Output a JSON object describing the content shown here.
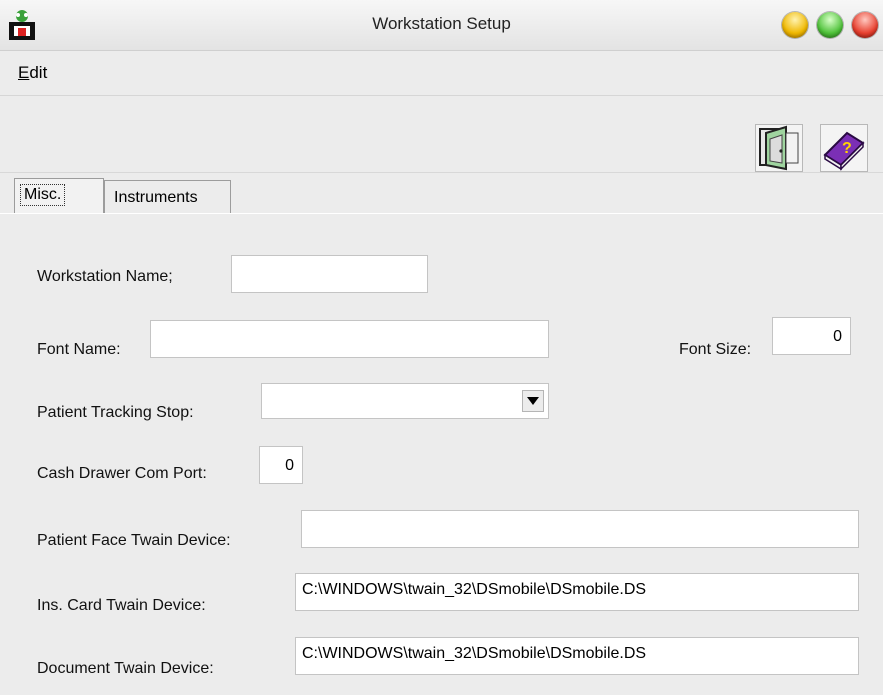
{
  "window": {
    "title": "Workstation Setup",
    "app_icon": "app-logo-icon",
    "controls": [
      "minimize-button",
      "zoom-button",
      "close-button"
    ]
  },
  "menu": {
    "items": [
      "Edit"
    ]
  },
  "toolbar": {
    "buttons": [
      {
        "icon": "exit-door-icon"
      },
      {
        "icon": "help-book-icon"
      }
    ]
  },
  "tabs": [
    {
      "label": "Misc.",
      "active": true
    },
    {
      "label": "Instruments",
      "active": false
    }
  ],
  "form": {
    "workstation_name": {
      "label": "Workstation Name;",
      "value": ""
    },
    "font_name": {
      "label": "Font Name:",
      "value": ""
    },
    "font_size": {
      "label": "Font Size:",
      "value": "0"
    },
    "patient_tracking_stop": {
      "label": "Patient Tracking Stop:",
      "value": ""
    },
    "cash_drawer_com_port": {
      "label": "Cash Drawer Com Port:",
      "value": "0"
    },
    "patient_face_twain": {
      "label": "Patient Face Twain Device:",
      "value": ""
    },
    "ins_card_twain": {
      "label": "Ins. Card Twain Device:",
      "value": "C:\\WINDOWS\\twain_32\\DSmobile\\DSmobile.DS"
    },
    "document_twain": {
      "label": "Document Twain Device:",
      "value": "C:\\WINDOWS\\twain_32\\DSmobile\\DSmobile.DS"
    }
  },
  "colors": {
    "window_bg": "#ececec",
    "field_bg": "#ffffff"
  }
}
